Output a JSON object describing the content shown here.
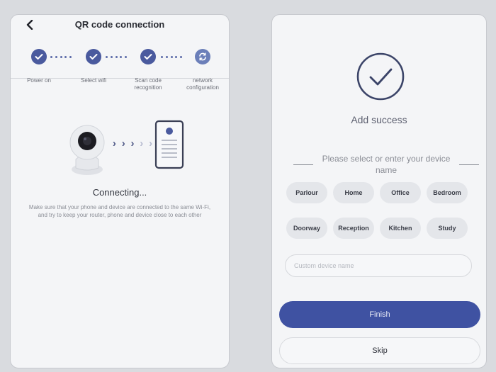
{
  "left_screen": {
    "title": "QR code connection",
    "steps": [
      {
        "label": "Power on",
        "state": "done"
      },
      {
        "label": "Select wifi",
        "state": "done"
      },
      {
        "label": "Scan code recognition",
        "state": "done"
      },
      {
        "label": "network configuration",
        "state": "in-progress"
      }
    ],
    "status_title": "Connecting...",
    "status_description": "Make sure that your phone and device are connected to the same Wi-Fi, and try to keep your router, phone and device close to each other",
    "icons": [
      "back-icon",
      "check-icon",
      "sync-icon",
      "camera-icon",
      "phone-icon",
      "arrow-icon"
    ]
  },
  "right_screen": {
    "success_title": "Add success",
    "name_prompt": "Please select or enter your device name",
    "room_options": [
      "Parlour",
      "Home",
      "Office",
      "Bedroom",
      "Doorway",
      "Reception",
      "Kitchen",
      "Study"
    ],
    "custom_name_placeholder": "Custom device name",
    "finish_label": "Finish",
    "skip_label": "Skip",
    "icons": [
      "check-circle-icon"
    ]
  },
  "colors": {
    "accent": "#3f52a2",
    "step": "#4a5a9e",
    "panel_bg": "#f4f5f7",
    "chip_bg": "#e4e6ea",
    "page_bg": "#d9dbdf"
  }
}
